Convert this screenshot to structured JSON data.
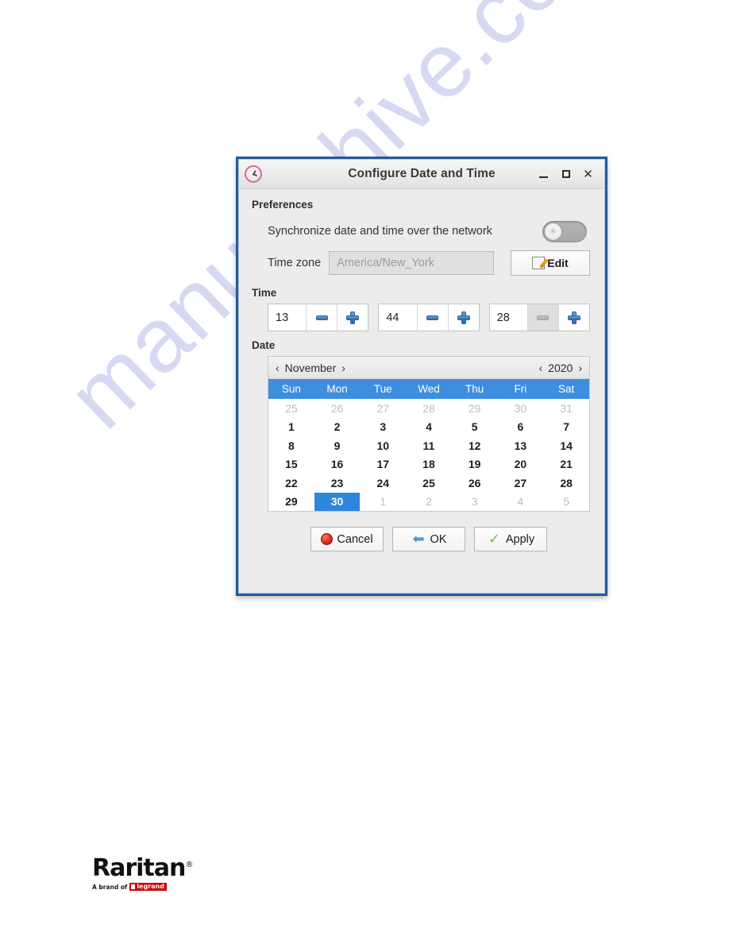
{
  "watermark": {
    "text": "manualshive.com"
  },
  "window": {
    "title": "Configure Date and Time",
    "icon": "clock-icon",
    "controls": {
      "minimize": "–",
      "maximize": "□",
      "close": "✕"
    }
  },
  "preferences": {
    "section_label": "Preferences",
    "sync_label": "Synchronize date and time over the network",
    "sync_enabled": false,
    "timezone_label": "Time zone",
    "timezone_value": "America/New_York",
    "edit_button": "Edit"
  },
  "time": {
    "section_label": "Time",
    "fields": [
      {
        "name": "hours",
        "value": "13",
        "minus": "−",
        "plus": "+",
        "minus_dim": false
      },
      {
        "name": "minutes",
        "value": "44",
        "minus": "−",
        "plus": "+",
        "minus_dim": false
      },
      {
        "name": "seconds",
        "value": "28",
        "minus": "−",
        "plus": "+",
        "minus_dim": true
      }
    ]
  },
  "date": {
    "section_label": "Date",
    "month": "November",
    "year": "2020",
    "prev_arrow": "‹",
    "next_arrow": "›",
    "weekdays": [
      "Sun",
      "Mon",
      "Tue",
      "Wed",
      "Thu",
      "Fri",
      "Sat"
    ],
    "selected_day": 30,
    "weeks": [
      [
        {
          "d": "25",
          "o": true
        },
        {
          "d": "26",
          "o": true
        },
        {
          "d": "27",
          "o": true
        },
        {
          "d": "28",
          "o": true
        },
        {
          "d": "29",
          "o": true
        },
        {
          "d": "30",
          "o": true
        },
        {
          "d": "31",
          "o": true
        }
      ],
      [
        {
          "d": "1",
          "o": false
        },
        {
          "d": "2",
          "o": false
        },
        {
          "d": "3",
          "o": false
        },
        {
          "d": "4",
          "o": false
        },
        {
          "d": "5",
          "o": false
        },
        {
          "d": "6",
          "o": false
        },
        {
          "d": "7",
          "o": false
        }
      ],
      [
        {
          "d": "8",
          "o": false
        },
        {
          "d": "9",
          "o": false
        },
        {
          "d": "10",
          "o": false
        },
        {
          "d": "11",
          "o": false
        },
        {
          "d": "12",
          "o": false
        },
        {
          "d": "13",
          "o": false
        },
        {
          "d": "14",
          "o": false
        }
      ],
      [
        {
          "d": "15",
          "o": false
        },
        {
          "d": "16",
          "o": false
        },
        {
          "d": "17",
          "o": false
        },
        {
          "d": "18",
          "o": false
        },
        {
          "d": "19",
          "o": false
        },
        {
          "d": "20",
          "o": false
        },
        {
          "d": "21",
          "o": false
        }
      ],
      [
        {
          "d": "22",
          "o": false
        },
        {
          "d": "23",
          "o": false
        },
        {
          "d": "24",
          "o": false
        },
        {
          "d": "25",
          "o": false
        },
        {
          "d": "26",
          "o": false
        },
        {
          "d": "27",
          "o": false
        },
        {
          "d": "28",
          "o": false
        }
      ],
      [
        {
          "d": "29",
          "o": false
        },
        {
          "d": "30",
          "o": false,
          "sel": true
        },
        {
          "d": "1",
          "o": true
        },
        {
          "d": "2",
          "o": true
        },
        {
          "d": "3",
          "o": true
        },
        {
          "d": "4",
          "o": true
        },
        {
          "d": "5",
          "o": true
        }
      ]
    ]
  },
  "footer": {
    "cancel": "Cancel",
    "ok": "OK",
    "apply": "Apply"
  },
  "logo": {
    "brand": "Raritan",
    "registered": "®",
    "tagline": "A brand of",
    "parent": "legrand",
    "parent_registered": "®"
  },
  "colors": {
    "window_border": "#1f5c9e",
    "calendar_header": "#3d8ede",
    "selected_day": "#2f86df",
    "accent_blue": "#2f6bad",
    "brand_red": "#cc0000"
  }
}
